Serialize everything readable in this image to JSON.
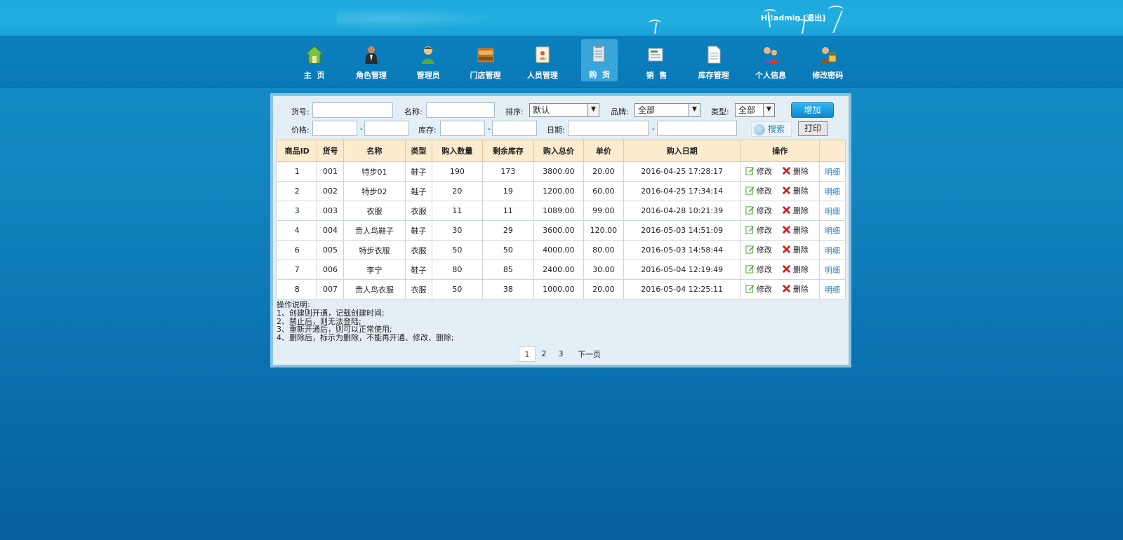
{
  "header": {
    "greeting": "Hi!",
    "username": "admin",
    "logout_label": "[退出]"
  },
  "nav": {
    "items": [
      {
        "label": "主  页",
        "icon": "home-icon"
      },
      {
        "label": "角色管理",
        "icon": "role-icon"
      },
      {
        "label": "管理员",
        "icon": "admin-icon"
      },
      {
        "label": "门店管理",
        "icon": "store-icon"
      },
      {
        "label": "人员管理",
        "icon": "staff-icon"
      },
      {
        "label": "购  货",
        "icon": "purchase-icon",
        "active": true
      },
      {
        "label": "销  售",
        "icon": "sales-icon"
      },
      {
        "label": "库存管理",
        "icon": "inventory-icon"
      },
      {
        "label": "个人信息",
        "icon": "profile-icon"
      },
      {
        "label": "修改密码",
        "icon": "password-icon"
      }
    ]
  },
  "filters": {
    "code_label": "货号:",
    "name_label": "名称:",
    "sort_label": "排序:",
    "sort_value": "默认",
    "brand_label": "品牌:",
    "brand_value": "全部",
    "type_label": "类型:",
    "type_value": "全部",
    "add_label": "增加",
    "price_label": "价格:",
    "stock_label": "库存:",
    "date_label": "日期:",
    "range_sep": "-",
    "search_label": "搜索",
    "print_label": "打印"
  },
  "table": {
    "headers": [
      "商品ID",
      "货号",
      "名称",
      "类型",
      "购入数量",
      "剩余库存",
      "购入总价",
      "单价",
      "购入日期",
      "操作",
      ""
    ],
    "edit_label": "修改",
    "delete_label": "删除",
    "detail_label": "明细",
    "rows": [
      [
        "1",
        "001",
        "特步01",
        "鞋子",
        "190",
        "173",
        "3800.00",
        "20.00",
        "2016-04-25 17:28:17"
      ],
      [
        "2",
        "002",
        "特步02",
        "鞋子",
        "20",
        "19",
        "1200.00",
        "60.00",
        "2016-04-25 17:34:14"
      ],
      [
        "3",
        "003",
        "衣服",
        "衣服",
        "11",
        "11",
        "1089.00",
        "99.00",
        "2016-04-28 10:21:39"
      ],
      [
        "4",
        "004",
        "贵人鸟鞋子",
        "鞋子",
        "30",
        "29",
        "3600.00",
        "120.00",
        "2016-05-03 14:51:09"
      ],
      [
        "6",
        "005",
        "特步衣服",
        "衣服",
        "50",
        "50",
        "4000.00",
        "80.00",
        "2016-05-03 14:58:44"
      ],
      [
        "7",
        "006",
        "李宁",
        "鞋子",
        "80",
        "85",
        "2400.00",
        "30.00",
        "2016-05-04 12:19:49"
      ],
      [
        "8",
        "007",
        "贵人鸟衣服",
        "衣服",
        "50",
        "38",
        "1000.00",
        "20.00",
        "2016-05-04 12:25:11"
      ]
    ]
  },
  "notes": {
    "title": "操作说明:",
    "lines": [
      "1、创建则开通，记载创建时间;",
      "2、禁止后，则无法登陆;",
      "3、重新开通后，则可以正常使用;",
      "4、删除后，标示为删除，不能再开通、修改、删除;"
    ]
  },
  "pager": {
    "pages": [
      "1",
      "2",
      "3"
    ],
    "current": "1",
    "next_label": "下一页"
  },
  "colors": {
    "header_bg": "#fdebcf",
    "panel_bg": "#e4eff5",
    "link": "#2d7fc4",
    "add_button": "#1b9be0"
  }
}
